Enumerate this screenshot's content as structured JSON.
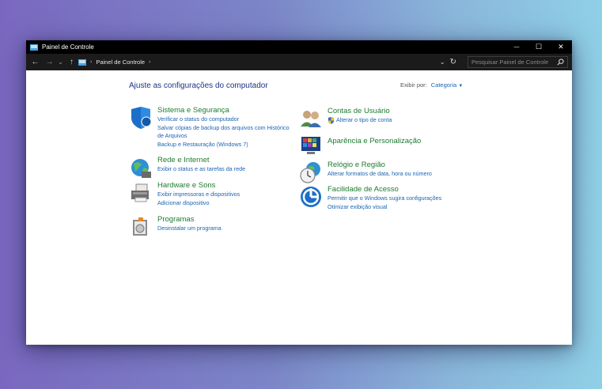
{
  "window": {
    "title": "Painel de Controle",
    "minimize": "—",
    "maximize": "☐",
    "close": "✕"
  },
  "nav": {
    "back": "←",
    "forward": "→",
    "recent": "⌄",
    "up": "↑",
    "breadcrumb": "Painel de Controle",
    "refresh": "↻",
    "search_placeholder": "Pesquisar Painel de Controle"
  },
  "main": {
    "heading": "Ajuste as configurações do computador",
    "view_by_label": "Exibir por:",
    "view_by_value": "Categoria"
  },
  "categories_left": [
    {
      "title": "Sistema e Segurança",
      "links": [
        "Verificar o status do computador",
        "Salvar cópias de backup dos arquivos com Histórico",
        "de Arquivos",
        "Backup e Restauração (Windows 7)"
      ]
    },
    {
      "title": "Rede e Internet",
      "links": [
        "Exibir o status e as tarefas da rede"
      ]
    },
    {
      "title": "Hardware e Sons",
      "links": [
        "Exibir impressoras e dispositivos",
        "Adicionar dispositivo"
      ]
    },
    {
      "title": "Programas",
      "links": [
        "Desinstalar um programa"
      ]
    }
  ],
  "categories_right": [
    {
      "title": "Contas de Usuário",
      "links": [
        "Alterar o tipo de conta"
      ]
    },
    {
      "title": "Aparência e Personalização",
      "links": []
    },
    {
      "title": "Relógio e Região",
      "links": [
        "Alterar formatos de data, hora ou número"
      ]
    },
    {
      "title": "Facilidade de Acesso",
      "links": [
        "Permitir que o Windows sugira configurações",
        "Otimizar exibição visual"
      ]
    }
  ],
  "colors": {
    "heading": "#1e3287",
    "category_title": "#1d7b30",
    "link": "#1a64b4"
  }
}
